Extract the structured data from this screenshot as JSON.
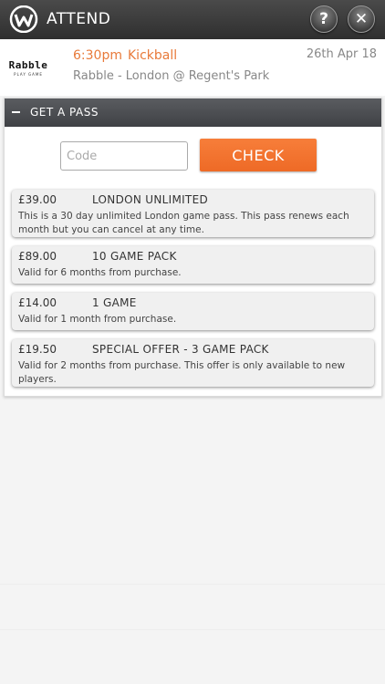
{
  "header": {
    "title": "ATTEND",
    "help_label": "?",
    "close_label": "✕",
    "logo_icon": "w-logo-icon"
  },
  "event": {
    "logo": "Rabble",
    "logo_sub": "PLAY GAME",
    "time": "6:30pm",
    "name": "Kickball",
    "date": "26th Apr 18",
    "location": "Rabble - London @ Regent's Park"
  },
  "pass_section": {
    "title": "GET A PASS",
    "code_placeholder": "Code",
    "code_value": "",
    "check_label": "CHECK",
    "accent_color": "#f0712c",
    "passes": [
      {
        "price": "£39.00",
        "name": "LONDON UNLIMITED",
        "description": "This is a 30 day unlimited London game pass. This pass renews each month but you can cancel at any time."
      },
      {
        "price": "£89.00",
        "name": "10 GAME PACK",
        "description": "Valid for 6 months from purchase."
      },
      {
        "price": "£14.00",
        "name": "1 GAME",
        "description": "Valid for 1 month from purchase."
      },
      {
        "price": "£19.50",
        "name": "SPECIAL OFFER - 3 GAME PACK",
        "description": "Valid for 2 months from purchase. This offer is only available to new players."
      }
    ]
  }
}
